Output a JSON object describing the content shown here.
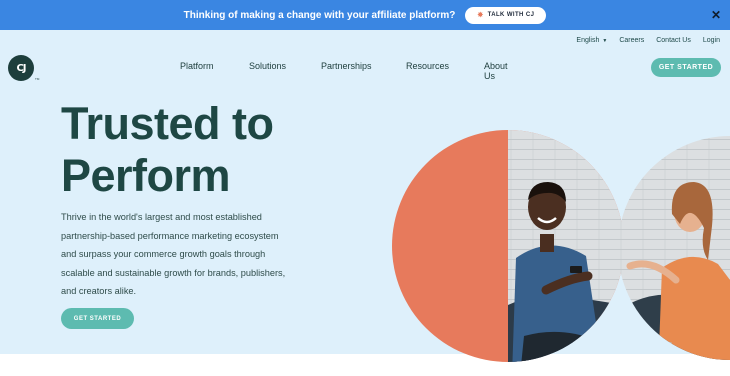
{
  "banner": {
    "text": "Thinking of making a change with your affiliate platform?",
    "button_label": "TALK WITH CJ",
    "close_symbol": "✕",
    "color": "#3a86e2"
  },
  "utility_nav": {
    "language": "English",
    "links": [
      "Careers",
      "Contact Us",
      "Login"
    ]
  },
  "logo": {
    "text": "CJ",
    "trademark": "TM",
    "color": "#1d3e3c"
  },
  "main_nav": {
    "items": [
      "Platform",
      "Solutions",
      "Partnerships",
      "Resources",
      "About Us"
    ],
    "cta_label": "GET STARTED"
  },
  "hero": {
    "headline_line1": "Trusted to",
    "headline_line2": "Perform",
    "body_lines": [
      "Thrive in the world's largest and most established",
      "partnership-based performance marketing ecosystem",
      "and surpass your commerce growth goals through",
      "scalable and sustainable growth for brands, publishers,",
      "and creators alike."
    ],
    "cta_label": "GET STARTED",
    "background": "#def0fb",
    "accent": "#5dbbb0",
    "coral": "#e77a5c"
  },
  "icons": {
    "close": "close-icon",
    "language_caret": "chevron-down-icon",
    "sparkle": "sparkle-icon"
  }
}
